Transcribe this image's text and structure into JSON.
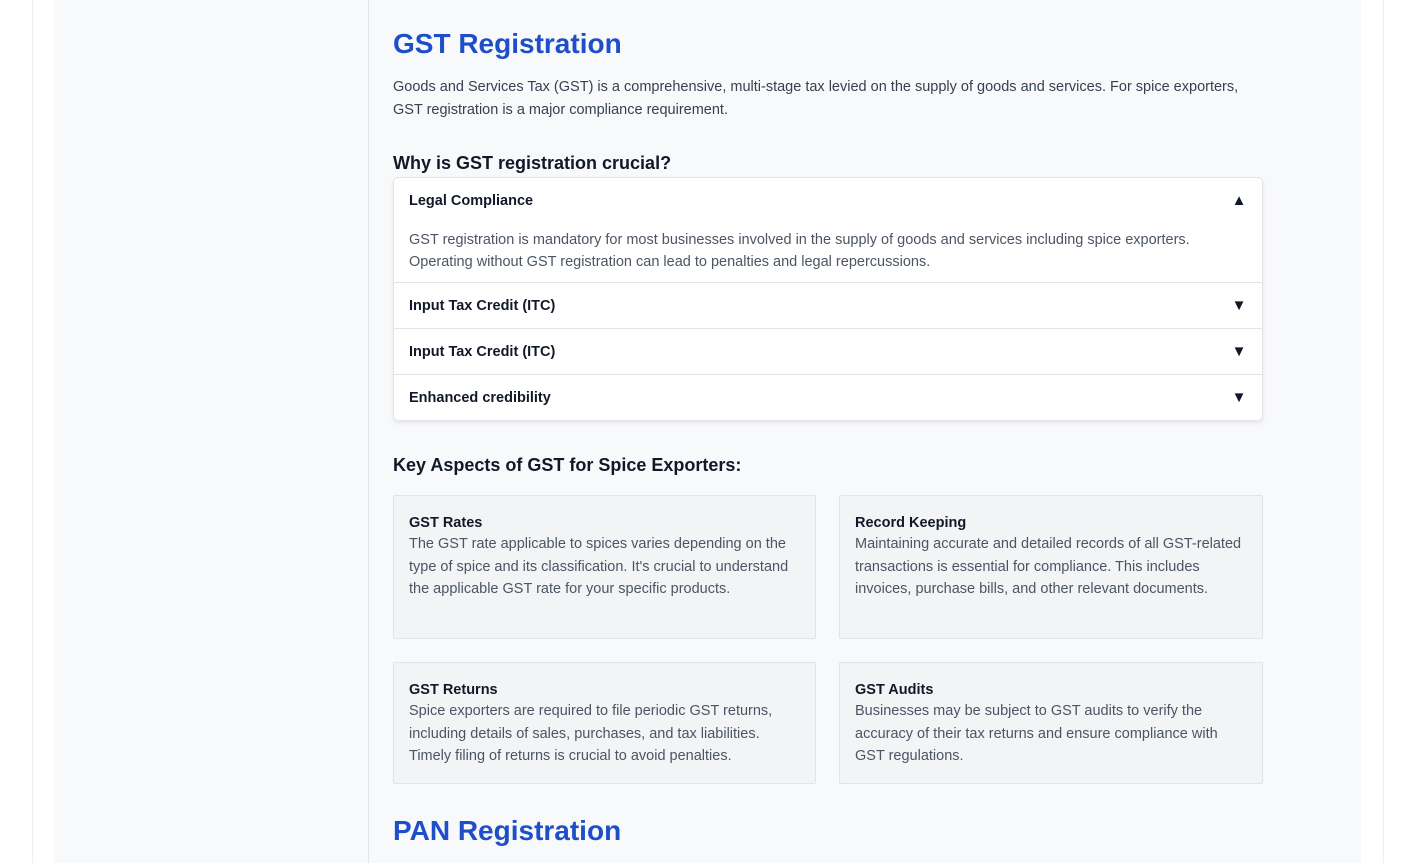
{
  "gst": {
    "title": "GST Registration",
    "intro": "Goods and Services Tax (GST) is a comprehensive, multi-stage tax levied on the supply of goods and services. For spice exporters, GST registration is a major compliance requirement.",
    "why_heading": "Why is GST registration crucial?",
    "accordion": [
      {
        "title": "Legal Compliance",
        "expanded": true,
        "arrow": "▲",
        "body": "GST registration is mandatory for most businesses involved in the supply of goods and services including spice exporters. Operating without GST registration can lead to penalties and legal repercussions."
      },
      {
        "title": "Input Tax Credit (ITC)",
        "expanded": false,
        "arrow": "▼"
      },
      {
        "title": "Input Tax Credit (ITC)",
        "expanded": false,
        "arrow": "▼"
      },
      {
        "title": "Enhanced credibility",
        "expanded": false,
        "arrow": "▼"
      }
    ],
    "aspects_heading": "Key Aspects of GST for Spice Exporters:",
    "cards": [
      {
        "title": "GST Rates",
        "text": "The GST rate applicable to spices varies depending on the type of spice and its classification. It's crucial to understand the applicable GST rate for your specific products."
      },
      {
        "title": "Record Keeping",
        "text": "Maintaining accurate and detailed records of all GST-related transactions is essential for compliance. This includes invoices, purchase bills, and other relevant documents."
      },
      {
        "title": "GST Returns",
        "text": "Spice exporters are required to file periodic GST returns, including details of sales, purchases, and tax liabilities. Timely filing of returns is crucial to avoid penalties."
      },
      {
        "title": "GST Audits",
        "text": "Businesses may be subject to GST audits to verify the accuracy of their tax returns and ensure compliance with GST regulations."
      }
    ]
  },
  "pan": {
    "title": "PAN Registration"
  },
  "colors": {
    "heading_blue": "#1f4fc8",
    "page_bg": "#f8f9fa",
    "card_bg": "#f3f4f6"
  }
}
